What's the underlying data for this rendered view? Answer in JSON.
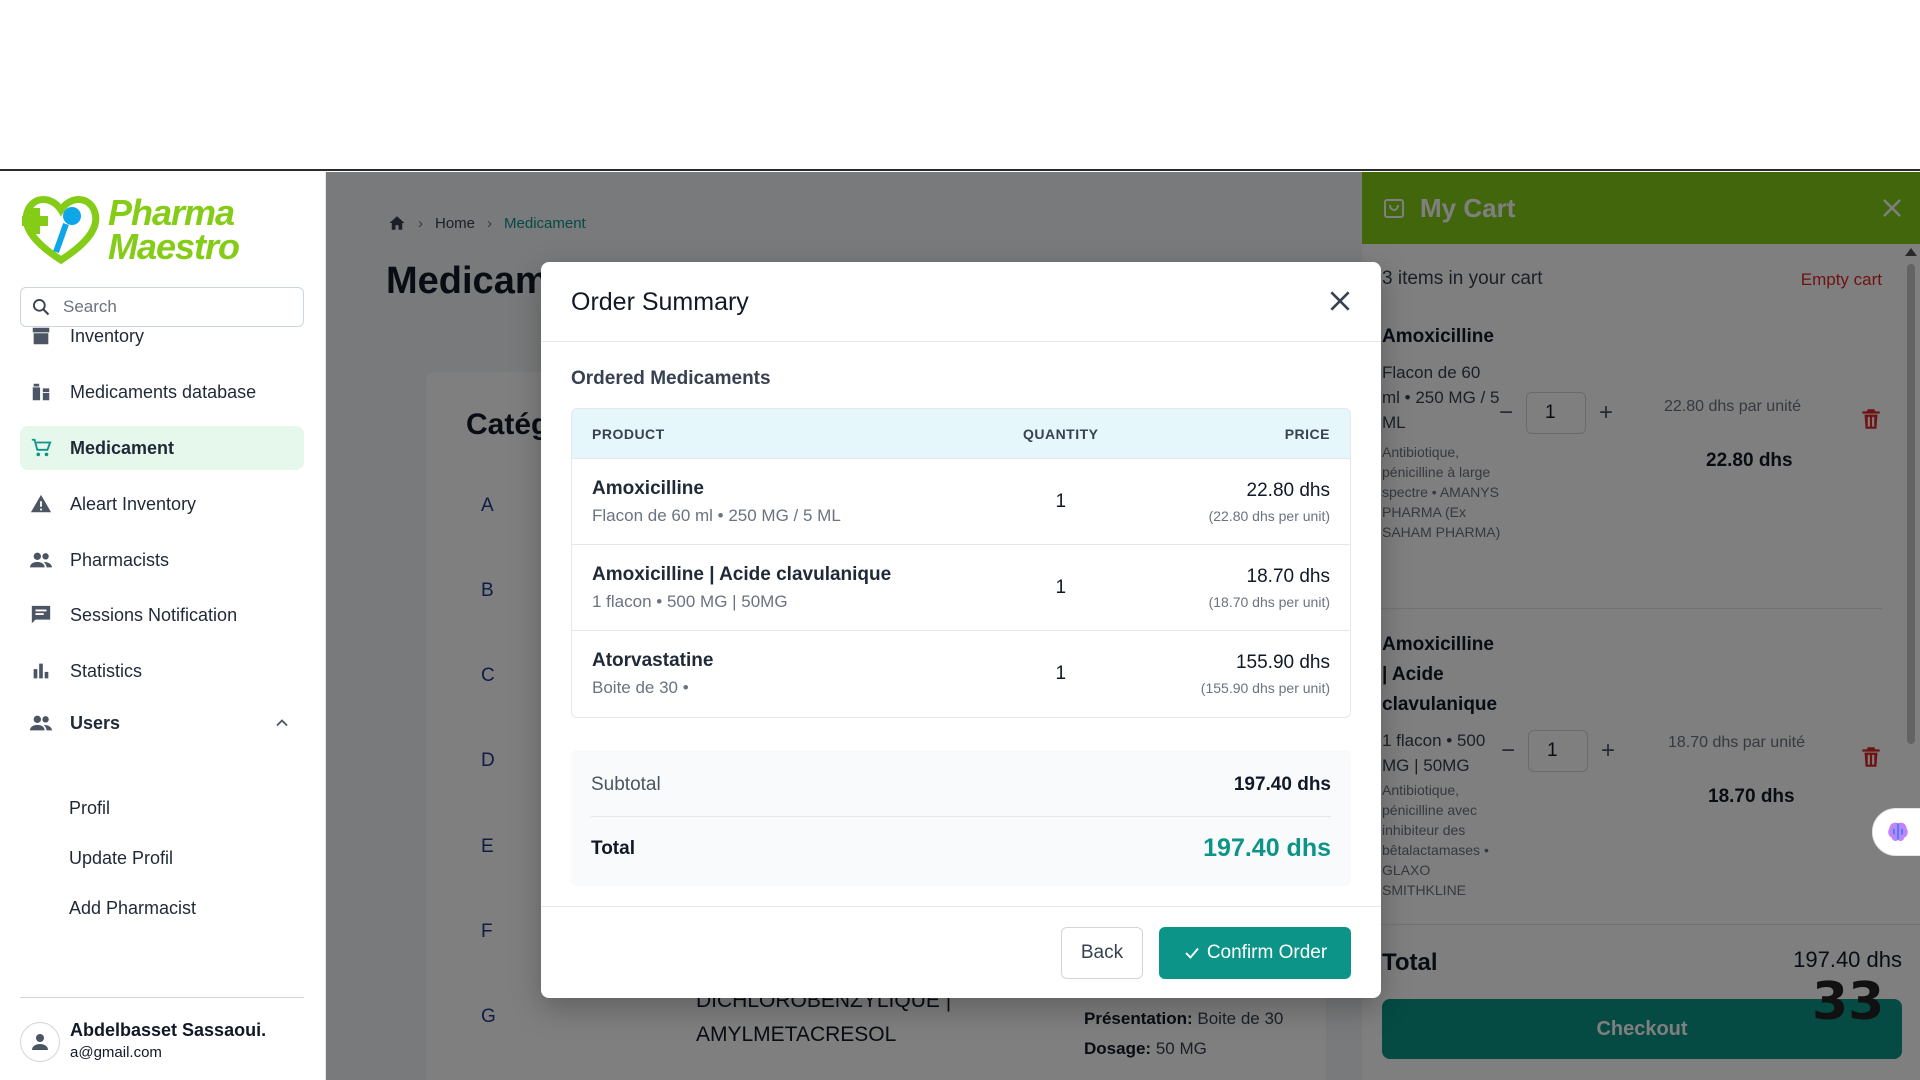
{
  "app": {
    "brand_line1": "Pharma",
    "brand_line2": "Maestro",
    "accent_color": "#0d9488",
    "brand_color": "#84cc16"
  },
  "sidebar": {
    "search_placeholder": "Search",
    "items": [
      {
        "label": "Inventory",
        "icon": "archive-icon"
      },
      {
        "label": "Medicaments database",
        "icon": "medicine-icon"
      },
      {
        "label": "Medicament",
        "icon": "cart-icon",
        "active": true
      },
      {
        "label": "Aleart Inventory",
        "icon": "warning-icon"
      },
      {
        "label": "Pharmacists",
        "icon": "people-icon"
      },
      {
        "label": "Sessions Notification",
        "icon": "chat-icon"
      },
      {
        "label": "Statistics",
        "icon": "bar-chart-icon"
      },
      {
        "label": "Users",
        "icon": "people-icon",
        "expanded": true
      }
    ],
    "sub_items": [
      "Profil",
      "Update Profil",
      "Add Pharmacist"
    ],
    "user": {
      "name": "Abdelbasset Sassaoui.",
      "email": "a@gmail.com"
    }
  },
  "main": {
    "breadcrumb": {
      "home": "Home",
      "current": "Medicament"
    },
    "title": "Medicam",
    "categories_title": "Catégo",
    "letters": [
      "A",
      "B",
      "C",
      "D",
      "E",
      "F",
      "G"
    ],
    "bg_product": [
      "DICHLOROBENZYLIQUE |",
      "AMYLMETACRESOL"
    ],
    "bg_presentation_label": "Présentation:",
    "bg_presentation_value": "Boite de 30",
    "bg_dosage_label": "Dosage:",
    "bg_dosage_value": "50 MG"
  },
  "cart": {
    "title": "My Cart",
    "count_text": "3 items in your cart",
    "empty_label": "Empty cart",
    "items": [
      {
        "name": "Amoxicilline",
        "presentation": "Flacon de 60 ml • 250 MG / 5 ML",
        "description": "Antibiotique, pénicilline à large spectre • AMANYS PHARMA (Ex SAHAM PHARMA)",
        "quantity": "1",
        "unit_price": "22.80 dhs par unité",
        "line_total": "22.80 dhs"
      },
      {
        "name": "Amoxicilline | Acide clavulanique",
        "presentation": "1 flacon • 500 MG | 50MG",
        "description": "Antibiotique, pénicilline avec inhibiteur des bêtalactamases • GLAXO SMITHKLINE",
        "quantity": "1",
        "unit_price": "18.70 dhs par unité",
        "line_total": "18.70 dhs"
      }
    ],
    "total_label": "Total",
    "total_value": "197.40 dhs",
    "checkout_label": "Checkout"
  },
  "overlay_badge": "33",
  "modal": {
    "title": "Order Summary",
    "section_title": "Ordered Medicaments",
    "headers": {
      "product": "PRODUCT",
      "quantity": "QUANTITY",
      "price": "PRICE"
    },
    "rows": [
      {
        "name": "Amoxicilline",
        "details": "Flacon de 60 ml • 250 MG / 5 ML",
        "quantity": "1",
        "price": "22.80 dhs",
        "unit": "(22.80 dhs per unit)"
      },
      {
        "name": "Amoxicilline | Acide clavulanique",
        "details": "1 flacon • 500 MG | 50MG",
        "quantity": "1",
        "price": "18.70 dhs",
        "unit": "(18.70 dhs per unit)"
      },
      {
        "name": "Atorvastatine",
        "details": "Boite de 30 •",
        "quantity": "1",
        "price": "155.90 dhs",
        "unit": "(155.90 dhs per unit)"
      }
    ],
    "subtotal_label": "Subtotal",
    "subtotal_value": "197.40 dhs",
    "total_label": "Total",
    "total_value": "197.40 dhs",
    "back_label": "Back",
    "confirm_label": "Confirm Order"
  }
}
